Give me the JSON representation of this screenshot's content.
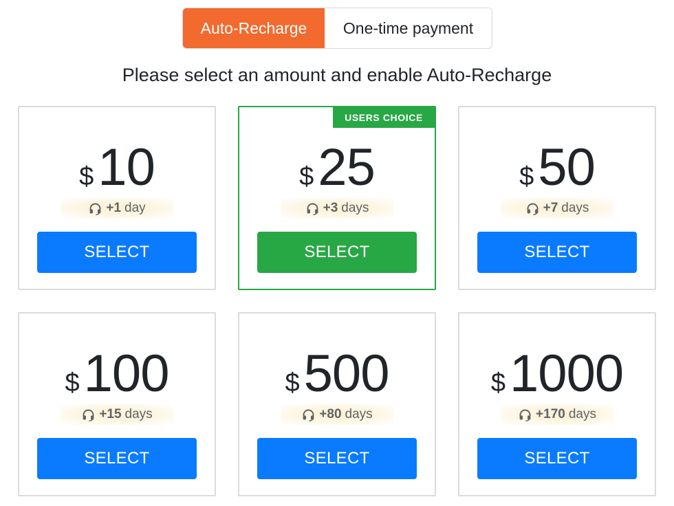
{
  "toggle": {
    "auto_recharge_label": "Auto-Recharge",
    "one_time_label": "One-time payment"
  },
  "heading": "Please select an amount and enable Auto-Recharge",
  "currency_symbol": "$",
  "featured_ribbon": "USERS CHOICE",
  "select_label": "SELECT",
  "colors": {
    "accent_orange": "#f26a2e",
    "select_blue": "#0a7bff",
    "featured_green": "#28a745"
  },
  "plans": [
    {
      "amount": "10",
      "bonus_value": "+1",
      "bonus_unit": "day"
    },
    {
      "amount": "25",
      "bonus_value": "+3",
      "bonus_unit": "days"
    },
    {
      "amount": "50",
      "bonus_value": "+7",
      "bonus_unit": "days"
    },
    {
      "amount": "100",
      "bonus_value": "+15",
      "bonus_unit": "days"
    },
    {
      "amount": "500",
      "bonus_value": "+80",
      "bonus_unit": "days"
    },
    {
      "amount": "1000",
      "bonus_value": "+170",
      "bonus_unit": "days"
    }
  ],
  "icons": {
    "bonus_icon": "headset-icon"
  }
}
